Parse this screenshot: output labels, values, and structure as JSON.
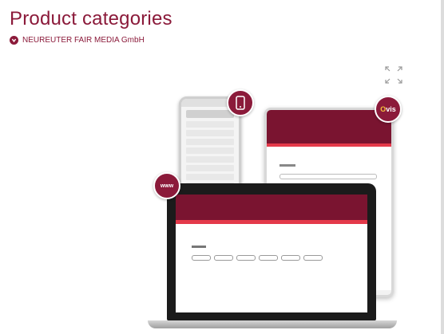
{
  "page": {
    "title": "Product categories"
  },
  "company": {
    "name": "NEUREUTER FAIR MEDIA GmbH",
    "icon": "chevron-down-icon"
  },
  "toolbar": {
    "expand_icon": "expand-icon"
  },
  "illustration": {
    "badges": {
      "ovis_prefix": "O",
      "ovis_rest": "vis",
      "www_label": "www"
    }
  },
  "colors": {
    "accent": "#8b1a3a",
    "nav": "#e4394a"
  }
}
